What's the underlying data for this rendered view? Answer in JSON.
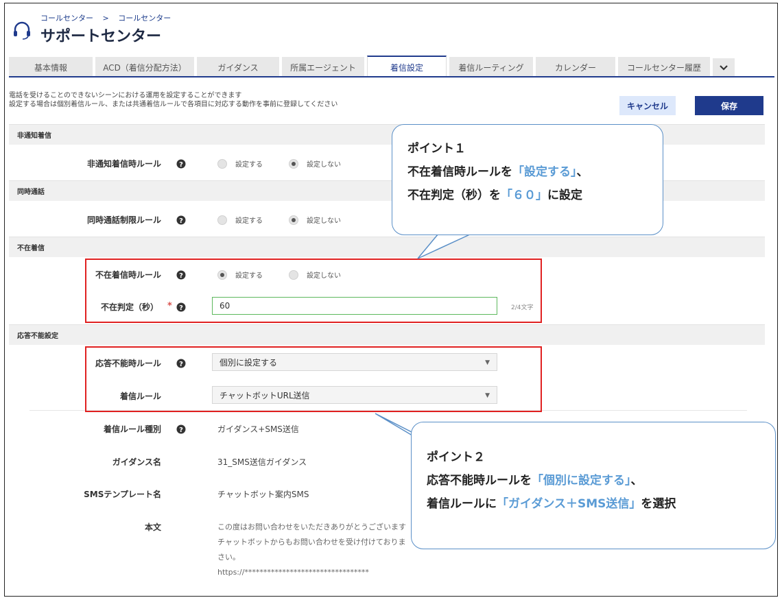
{
  "header": {
    "breadcrumb": [
      "コールセンター",
      ">",
      "コールセンター"
    ],
    "title": "サポートセンター",
    "icon": "headset-icon"
  },
  "tabs": [
    {
      "label": "基本情報"
    },
    {
      "label": "ACD（着信分配方法）"
    },
    {
      "label": "ガイダンス"
    },
    {
      "label": "所属エージェント"
    },
    {
      "label": "着信設定",
      "active": true
    },
    {
      "label": "着信ルーティング"
    },
    {
      "label": "カレンダー"
    },
    {
      "label": "コールセンター履歴"
    }
  ],
  "description": [
    "電話を受けることのできないシーンにおける運用を設定することができます",
    "設定する場合は個別着信ルール、または共通着信ルールで各項目に対応する動作を事前に登録してください"
  ],
  "buttons": {
    "cancel": "キャンセル",
    "save": "保存"
  },
  "sections": {
    "anonymous": {
      "title": "非通知着信",
      "rule_label": "非通知着信時ルール",
      "opt_on": "設定する",
      "opt_off": "設定しない",
      "selected": "off"
    },
    "concurrent": {
      "title": "同時通話",
      "rule_label": "同時通話制限ルール",
      "opt_on": "設定する",
      "opt_off": "設定しない",
      "selected": "off"
    },
    "absent": {
      "title": "不在着信",
      "rule_label": "不在着信時ルール",
      "opt_on": "設定する",
      "opt_off": "設定しない",
      "selected": "on",
      "timeout_label": "不在判定（秒）",
      "required_mark": "*",
      "timeout_value": "60",
      "counter": "2/4文字"
    },
    "unavailable": {
      "title": "応答不能設定",
      "rule_label": "応答不能時ルール",
      "rule_value": "個別に設定する",
      "incoming_label": "着信ルール",
      "incoming_value": "チャットボットURL送信",
      "type_label": "着信ルール種別",
      "type_value": "ガイダンス+SMS送信",
      "guidance_label": "ガイダンス名",
      "guidance_value": "31_SMS送信ガイダンス",
      "sms_label": "SMSテンプレート名",
      "sms_value": "チャットボット案内SMS",
      "body_label": "本文",
      "body_lines": [
        "この度はお問い合わせをいただきありがとうございます",
        "チャットボットからもお問い合わせを受け付けておりま",
        "さい。",
        "https://*********************************"
      ]
    }
  },
  "callouts": {
    "point1": {
      "heading": "ポイント１",
      "l2_a": "不在着信時ルールを",
      "l2_b": "「設定する」",
      "l2_c": "、",
      "l3_a": "不在判定（秒）を",
      "l3_b": "「６０」",
      "l3_c": "に設定"
    },
    "point2": {
      "heading": "ポイント２",
      "l2_a": "応答不能時ルールを",
      "l2_b": "「個別に設定する」",
      "l2_c": "、",
      "l3_a": "着信ルールに",
      "l3_b": "「ガイダンス＋SMS送信」",
      "l3_c": "を選択"
    }
  },
  "colors": {
    "accent": "#1f3a8c",
    "highlight": "#e02020",
    "callout_border": "#5a8fc7",
    "callout_emphasis": "#5a9bd5"
  }
}
